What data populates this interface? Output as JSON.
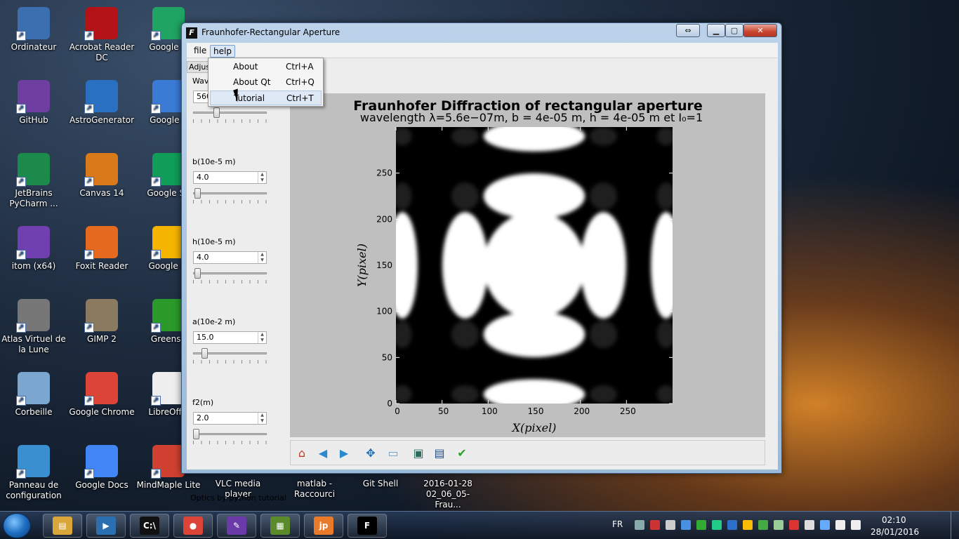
{
  "desktop": {
    "icons": [
      {
        "label": "Ordinateur",
        "color": "#3b6fb0"
      },
      {
        "label": "Acrobat Reader DC",
        "color": "#b31217"
      },
      {
        "label": "Google D",
        "color": "#1fa463"
      },
      {
        "label": "GitHub",
        "color": "#6e3fa0"
      },
      {
        "label": "AstroGenerator",
        "color": "#2a70c0"
      },
      {
        "label": "Google E",
        "color": "#3a7bd5"
      },
      {
        "label": "JetBrains PyCharm ...",
        "color": "#1c8a4a"
      },
      {
        "label": "Canvas 14",
        "color": "#d97a1a"
      },
      {
        "label": "Google Sh",
        "color": "#0f9d58"
      },
      {
        "label": "itom (x64)",
        "color": "#7040b0"
      },
      {
        "label": "Foxit Reader",
        "color": "#e56a1f"
      },
      {
        "label": "Google Sl",
        "color": "#f4b400"
      },
      {
        "label": "Atlas Virtuel de la Lune",
        "color": "#777777"
      },
      {
        "label": "GIMP 2",
        "color": "#8a7a60"
      },
      {
        "label": "Greensh",
        "color": "#2a9a2a"
      },
      {
        "label": "Corbeille",
        "color": "#7aa6d0"
      },
      {
        "label": "Google Chrome",
        "color": "#db4437"
      },
      {
        "label": "LibreOffic",
        "color": "#eeeeee"
      },
      {
        "label": "Panneau de configuration",
        "color": "#3a8fd0"
      },
      {
        "label": "Google Docs",
        "color": "#4285f4"
      },
      {
        "label": "MindMaple Lite",
        "color": "#d04030"
      }
    ],
    "bottom_row_labels": [
      "VLC media player",
      "matlab - Raccourci",
      "Git Shell",
      "2016-01-28 02_06_05-Frau..."
    ]
  },
  "window": {
    "title": "Fraunhofer-Rectangular Aperture",
    "menu": {
      "file": "file",
      "help": "help"
    },
    "help_menu": [
      {
        "label": "About",
        "shortcut": "Ctrl+A"
      },
      {
        "label": "About Qt",
        "shortcut": "Ctrl+Q"
      },
      {
        "label": "Tutorial",
        "shortcut": "Ctrl+T"
      }
    ],
    "tab_label": "Adjust",
    "params": [
      {
        "label": "Wave",
        "value": "560",
        "slider_fraction": 0.3
      },
      {
        "label": "b(10e-5 m)",
        "value": "4.0",
        "slider_fraction": 0.02
      },
      {
        "label": "h(10e-5 m)",
        "value": "4.0",
        "slider_fraction": 0.02
      },
      {
        "label": "a(10e-2 m)",
        "value": "15.0",
        "slider_fraction": 0.13
      },
      {
        "label": "f2(m)",
        "value": "2.0",
        "slider_fraction": 0.0
      }
    ],
    "footer": "Optics by python tutorial"
  },
  "chart_data": {
    "type": "heatmap",
    "title": "Fraunhofer Diffraction of rectangular aperture",
    "subtitle": "wavelength λ=5.6e−07m, b = 4e-05 m, h = 4e-05 m et I₀=1",
    "xlabel": "X(pixel)",
    "ylabel": "Y(pixel)",
    "xlim": [
      0,
      300
    ],
    "ylim": [
      0,
      300
    ],
    "xticks": [
      0,
      50,
      100,
      150,
      200,
      250
    ],
    "yticks": [
      0,
      50,
      100,
      150,
      200,
      250
    ],
    "colormap": "gray"
  },
  "taskbar": {
    "lang": "FR",
    "time": "02:10",
    "date": "28/01/2016",
    "apps": [
      "explorer",
      "media-player",
      "cmd",
      "chrome",
      "paint",
      "notepad",
      "jupyter",
      "fraunhofer-app"
    ]
  }
}
